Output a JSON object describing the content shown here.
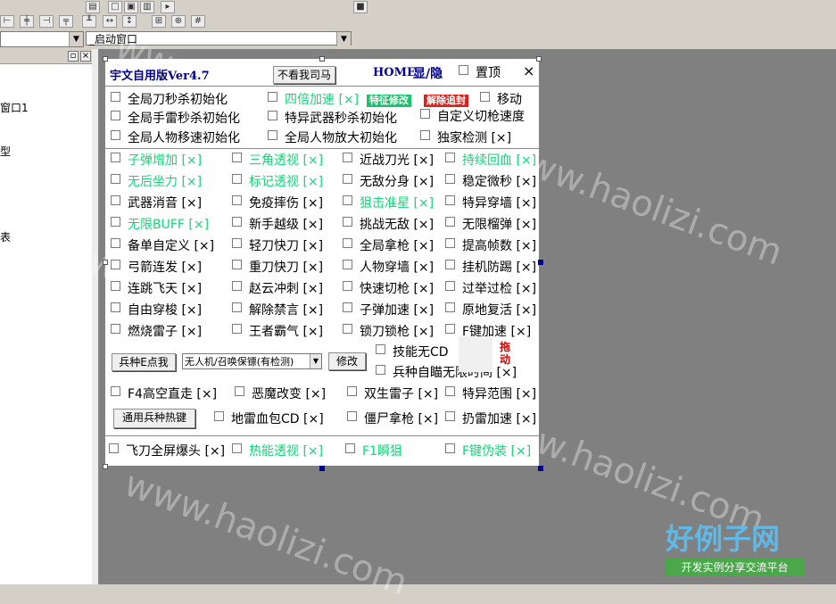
{
  "toolbar": {
    "icons": [
      "align-left-icon",
      "align-center-icon",
      "align-right-icon",
      "space-horizontal-icon",
      "space-vertical-icon",
      "same-width-icon",
      "same-height-icon",
      "same-size-icon",
      "center-icon",
      "grid-icon"
    ]
  },
  "selectors": {
    "object_select": "",
    "event_select": "_启动窗口"
  },
  "left_panel": {
    "items": [
      "窗口1",
      "型",
      "表"
    ]
  },
  "form": {
    "title": "宇文自用版Ver4.7",
    "no_look_button": "不看我司马",
    "home": "HOME",
    "show_hide": "显/隐",
    "topmost": "置顶",
    "close": "×",
    "badge_feature": "特征修改",
    "badge_untrack": "解除追封",
    "row1": [
      "全局刀秒杀初始化",
      "四倍加速 [×]",
      "移动"
    ],
    "row2": [
      "全局手雷秒杀初始化",
      "特异武器秒杀初始化",
      "自定义切枪速度"
    ],
    "row3": [
      "全局人物移速初始化",
      "全局人物放大初始化",
      "独家检测 [×]"
    ],
    "grid": [
      [
        "子弹增加 [×]",
        "三角透视 [×]",
        "近战刀光 [×]",
        "持续回血 [×]"
      ],
      [
        "无后坐力 [×]",
        "标记透视 [×]",
        "无敌分身 [×]",
        "稳定微秒 [×]"
      ],
      [
        "武器消音 [×]",
        "免疫摔伤 [×]",
        "狙击准星 [×]",
        "特异穿墙 [×]"
      ],
      [
        "无限BUFF [×]",
        "新手越级 [×]",
        "挑战无敌 [×]",
        "无限榴弹 [×]"
      ],
      [
        "备单自定义 [×]",
        "轻刀快刀 [×]",
        "全局拿枪 [×]",
        "提高帧数 [×]"
      ],
      [
        "弓箭连发 [×]",
        "重刀快刀 [×]",
        "人物穿墙 [×]",
        "挂机防踢 [×]"
      ],
      [
        "连跳飞天 [×]",
        "赵云冲刺 [×]",
        "快速切枪 [×]",
        "过举过检 [×]"
      ],
      [
        "自由穿梭 [×]",
        "解除禁言 [×]",
        "子弹加速 [×]",
        "原地复活 [×]"
      ],
      [
        "燃烧雷子 [×]",
        "王者霸气 [×]",
        "锁刀锁枪 [×]",
        "F键加速 [×]"
      ]
    ],
    "find_button": "兵种E点我",
    "combo_value": "无人机/召唤保镖(有检测)",
    "modify_button": "修改",
    "skill_cd": "技能无CD",
    "auto_aim": "兵种自瞄无限时间 [×]",
    "drag_label": "拖动",
    "row_f4": [
      "F4高空直走 [×]",
      "恶魔改变 [×]",
      "双生雷子 [×]",
      "特异范围 [×]"
    ],
    "hotkey_button": "通用兵种热键",
    "row_mine": [
      "地雷血包CD [×]",
      "僵尸拿枪 [×]",
      "扔雷加速 [×]"
    ],
    "row_last": [
      "飞刀全屏爆头 [×]",
      "热能透视 [×]",
      "F1瞬狙",
      "F键伪装 [×]"
    ]
  },
  "watermark": {
    "text": "www.haolizi.com",
    "logo_big": "好例子网",
    "logo_small": "开发实例分享交流平台"
  }
}
